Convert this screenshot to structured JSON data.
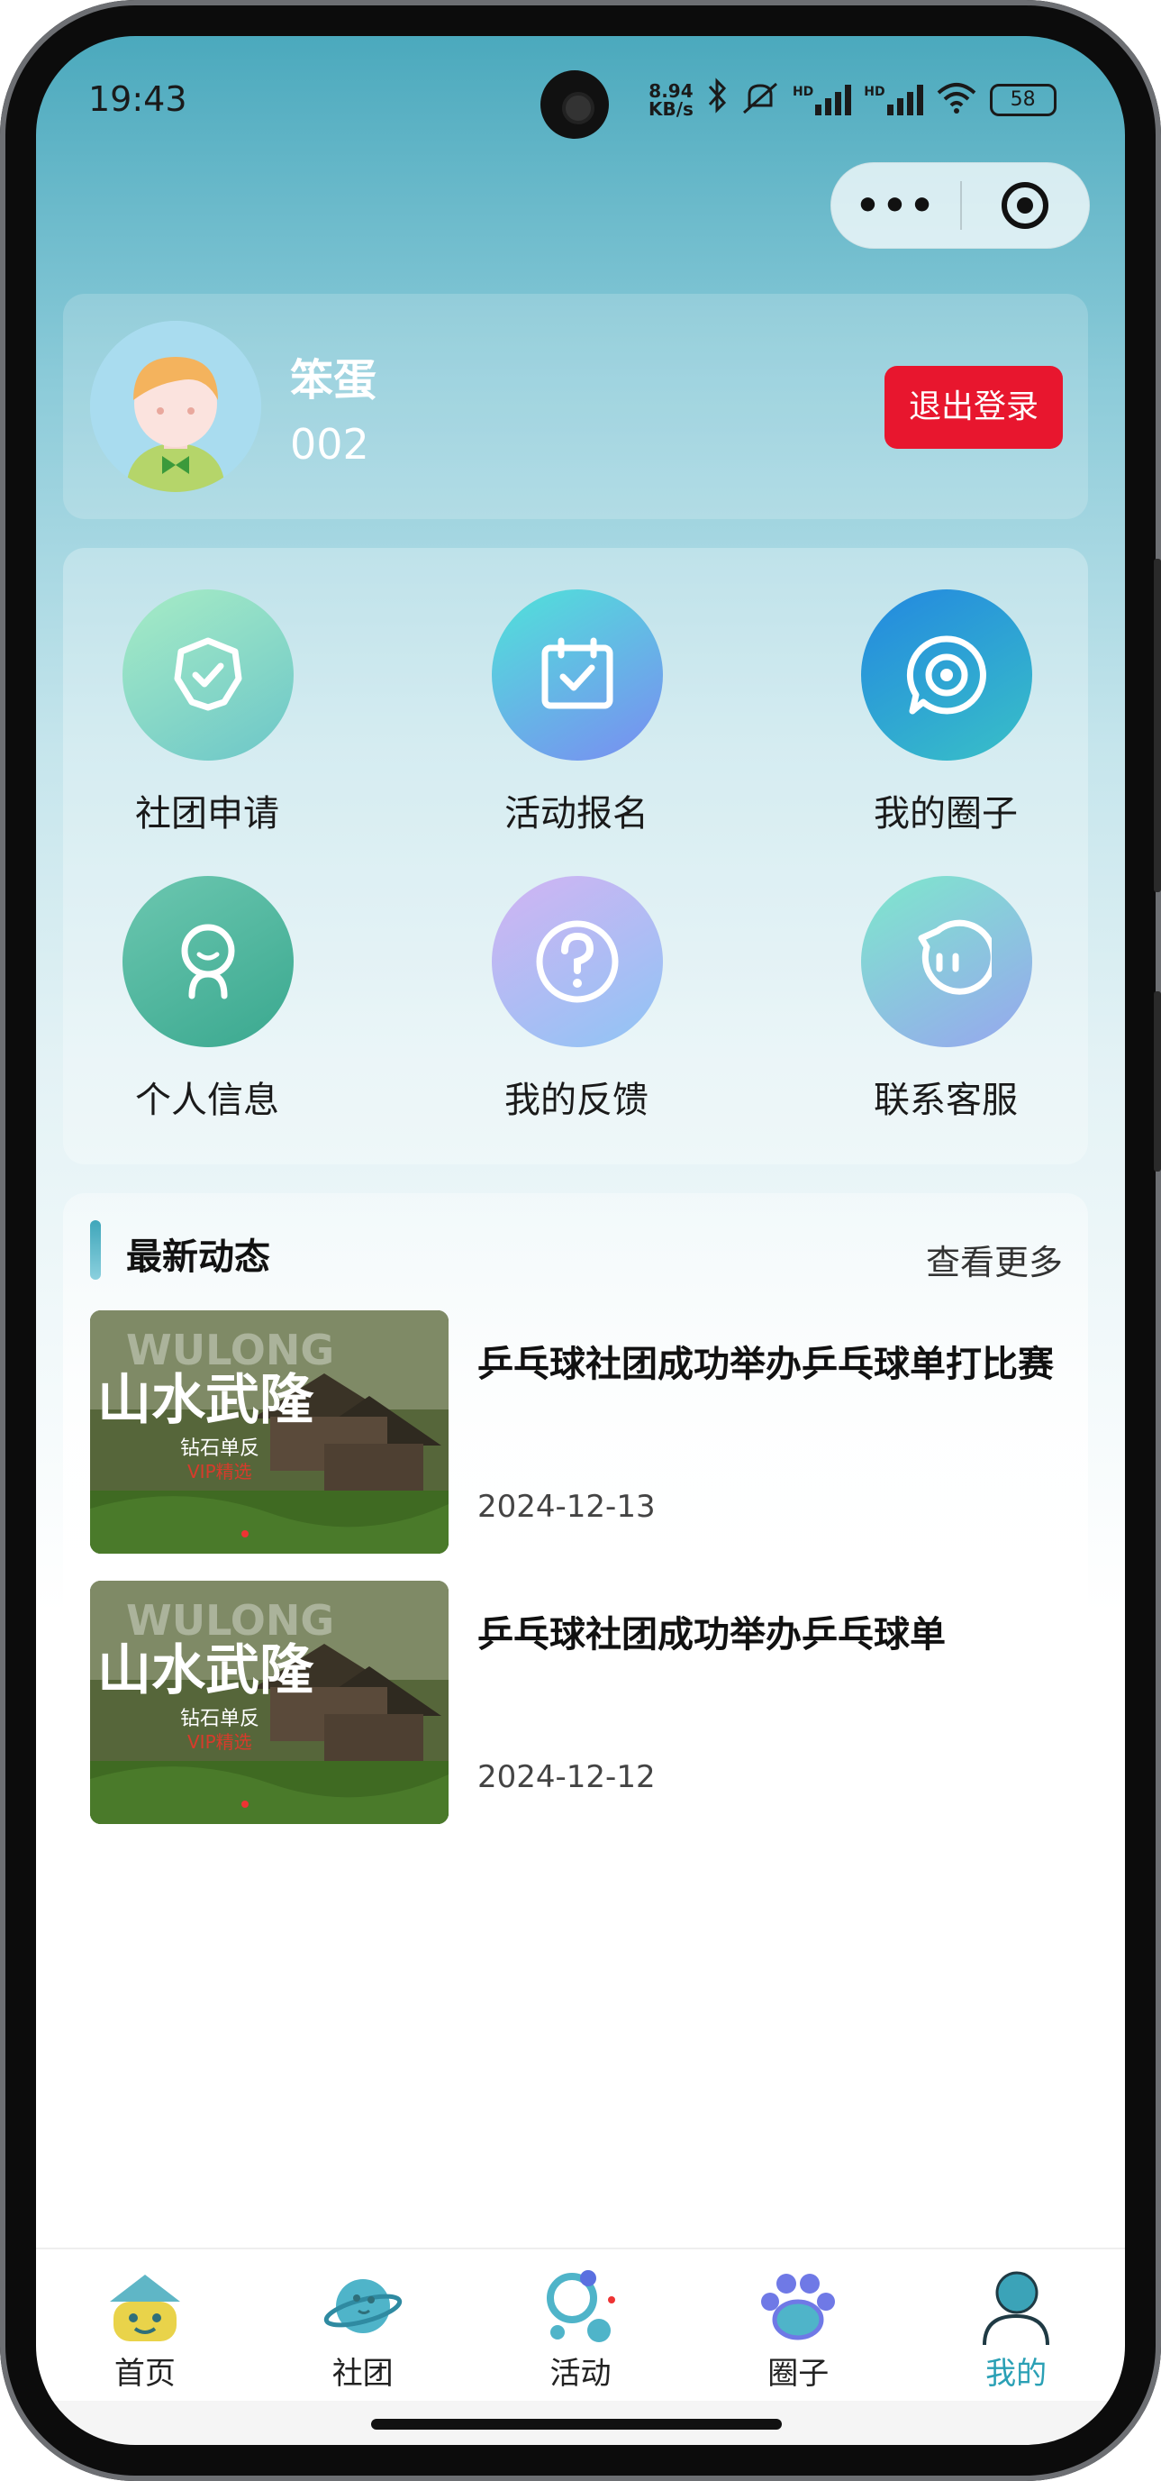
{
  "status_bar": {
    "time": "19:43",
    "net_speed_value": "8.94",
    "net_speed_unit": "KB/s",
    "signal_labels": [
      "HD",
      "HD"
    ],
    "battery": "58"
  },
  "capsule": {
    "more_label": "•••"
  },
  "profile": {
    "name": "笨蛋",
    "id": "002",
    "logout_label": "退出登录"
  },
  "menu": {
    "items": [
      {
        "label": "社团申请",
        "icon": "shield-check-icon",
        "gradient": [
          "#a7ecc6",
          "#6cc6c8"
        ]
      },
      {
        "label": "活动报名",
        "icon": "calendar-check-icon",
        "gradient": [
          "#4fe3d9",
          "#7a8cf2"
        ]
      },
      {
        "label": "我的圈子",
        "icon": "chat-target-icon",
        "gradient": [
          "#2388e0",
          "#39c0c7"
        ]
      },
      {
        "label": "个人信息",
        "icon": "person-icon",
        "gradient": [
          "#6cc7b0",
          "#3aa88f"
        ]
      },
      {
        "label": "我的反馈",
        "icon": "question-icon",
        "gradient": [
          "#d2b4f3",
          "#8fc4f4"
        ]
      },
      {
        "label": "联系客服",
        "icon": "service-face-icon",
        "gradient": [
          "#7ee8cc",
          "#97a6ef"
        ]
      }
    ]
  },
  "news": {
    "title": "最新动态",
    "more_label": "查看更多",
    "items": [
      {
        "title": "乒乓球社团成功举办乒乓球单打比赛",
        "date": "2024-12-13",
        "thumb_text": "山水武隆",
        "thumb_sub": "钻石单反",
        "thumb_sub2": "VIP精选",
        "thumb_bg_text": "WULONG"
      },
      {
        "title": "乒乓球社团成功举办乒乓球单",
        "date": "2024-12-12",
        "thumb_text": "山水武隆",
        "thumb_sub": "钻石单反",
        "thumb_sub2": "VIP精选",
        "thumb_bg_text": "WULONG"
      }
    ]
  },
  "bottom_nav": {
    "items": [
      {
        "label": "首页",
        "icon": "home-face-icon",
        "active": false
      },
      {
        "label": "社团",
        "icon": "planet-icon",
        "active": false
      },
      {
        "label": "活动",
        "icon": "bubbles-icon",
        "active": false
      },
      {
        "label": "圈子",
        "icon": "paw-icon",
        "active": false
      },
      {
        "label": "我的",
        "icon": "user-icon",
        "active": true
      }
    ]
  },
  "colors": {
    "accent": "#2aa0b5",
    "logout": "#e8162e"
  }
}
